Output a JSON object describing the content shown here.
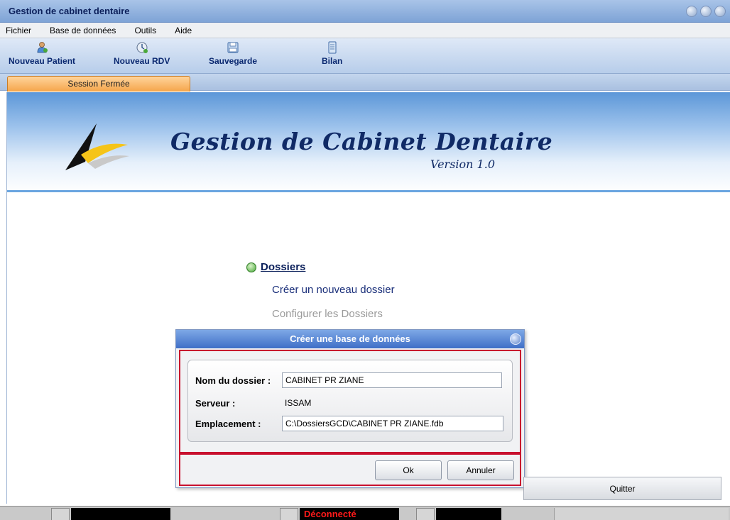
{
  "window": {
    "title": "Gestion de cabinet dentaire"
  },
  "menu": [
    "Fichier",
    "Base de données",
    "Outils",
    "Aide"
  ],
  "toolbar": {
    "new_patient": "Nouveau Patient",
    "new_rdv": "Nouveau RDV",
    "backup": "Sauvegarde",
    "report": "Bilan"
  },
  "session_tab": "Session Fermée",
  "banner": {
    "title": "Gestion de Cabinet Dentaire",
    "version": "Version 1.0"
  },
  "links": {
    "dossiers": "Dossiers",
    "create": "Créer un nouveau dossier",
    "configure": "Configurer les Dossiers"
  },
  "dialog": {
    "title": "Créer une base de données",
    "folder_label": "Nom du dossier :",
    "folder_value": "CABINET PR ZIANE",
    "server_label": "Serveur :",
    "server_value": "ISSAM",
    "location_label": "Emplacement :",
    "location_value": "C:\\DossiersGCD\\CABINET PR ZIANE.fdb",
    "ok": "Ok",
    "cancel": "Annuler"
  },
  "quit": "Quitter",
  "status": {
    "connection": "Déconnecté"
  },
  "colors": {
    "accent_blue": "#3f6fc7",
    "tab_orange": "#f5a54a",
    "highlight_red": "#c8102e",
    "status_red": "#ff1a1a"
  }
}
